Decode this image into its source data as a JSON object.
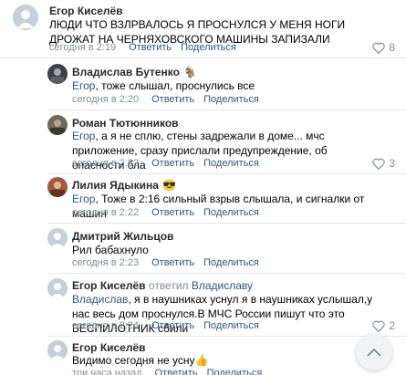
{
  "comments": [
    {
      "author": "Егор Киселёв",
      "text": "ЛЮДИ ЧТО ВЗЛРВАЛОСЬ Я ПРОСНУЛСЯ У МЕНЯ НОГИ ДРОЖАТ НА ЧЕРНЯХОВСКОГО МАШИНЫ ЗАПИЗАЛИ",
      "time": "сегодня в 2:19",
      "reply": "Ответить",
      "share": "Поделиться",
      "likes": "8"
    },
    {
      "author": "Владислав Бутенко",
      "author_emoji": "🐐",
      "text_mention": "Егор",
      "text": ", тоже слышал, проснулись все",
      "time": "сегодня в 2:20",
      "reply": "Ответить",
      "share": "Поделиться",
      "likes": ""
    },
    {
      "author": "Роман Тютюнников",
      "text_mention": "Егор",
      "text": ", а я не сплю, стены задрежали в доме... мчс приложение, сразу прислали предупреждение, об опасности бла",
      "time": "сегодня в 2:22",
      "reply": "Ответить",
      "share": "Поделиться",
      "likes": "3"
    },
    {
      "author": "Лилия Ядыкина",
      "author_emoji": "😎",
      "text_mention": "Егор",
      "text": ", Тоже в 2:16 сильный взрыв слышала, и сигналки от машин",
      "time": "сегодня в 2:22",
      "reply": "Ответить",
      "share": "Поделиться",
      "likes": ""
    },
    {
      "author": "Дмитрий Жильцов",
      "text": "Рил бабахнуло",
      "time": "сегодня в 2:23",
      "reply": "Ответить",
      "share": "Поделиться",
      "likes": ""
    },
    {
      "author": "Егор Киселёв",
      "answered": "ответил",
      "answered_to": "Владиславу",
      "text_mention": "Владислав",
      "text": ", я в наушниках уснул я в наушниках услышал,у нас весь дом проснулся.В МЧС России пишут что это БЕСПИЛОТНИК сбили",
      "time": "сегодня в 2:24",
      "reply": "Ответить",
      "share": "Поделиться",
      "likes": "2"
    },
    {
      "author": "Егор Киселёв",
      "text": "Видимо сегодня не усну",
      "text_emoji": "👍",
      "time": "три часа назад",
      "reply": "Ответить",
      "share": "Поделиться",
      "likes": ""
    }
  ],
  "colors": {
    "link": "#2a5885",
    "meta": "#818c99",
    "separator": "#e7e8ec"
  },
  "icons": {
    "like": "heart-icon",
    "scroll": "chevron-up-icon"
  }
}
